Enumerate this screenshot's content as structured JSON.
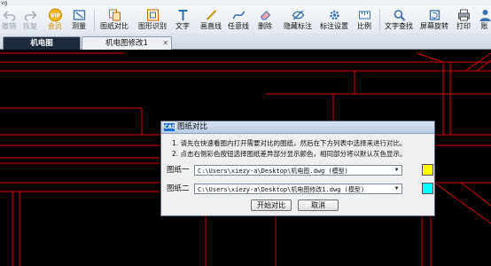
{
  "window": {
    "title": "vg"
  },
  "toolbar": {
    "items": [
      {
        "label": "撤销",
        "icon": "undo-icon",
        "enabled": false
      },
      {
        "label": "恢复",
        "icon": "redo-icon",
        "enabled": false
      },
      {
        "label": "会员",
        "icon": "vip-icon",
        "enabled": true
      },
      {
        "label": "测量",
        "icon": "measure-icon",
        "enabled": true
      },
      {
        "label": "图纸对比",
        "icon": "compare-icon",
        "enabled": true
      },
      {
        "label": "图形识别",
        "icon": "recognize-icon",
        "enabled": true
      },
      {
        "label": "文字",
        "icon": "text-icon",
        "enabled": true
      },
      {
        "label": "画直线",
        "icon": "line-icon",
        "enabled": true
      },
      {
        "label": "任意线",
        "icon": "freeline-icon",
        "enabled": true
      },
      {
        "label": "删除",
        "icon": "eraser-icon",
        "enabled": true
      },
      {
        "label": "隐藏标注",
        "icon": "hide-annotation-icon",
        "enabled": true
      },
      {
        "label": "标注设置",
        "icon": "annotation-settings-icon",
        "enabled": true
      },
      {
        "label": "比例",
        "icon": "scale-icon",
        "enabled": true
      },
      {
        "label": "文字查找",
        "icon": "text-search-icon",
        "enabled": true
      },
      {
        "label": "屏幕旋转",
        "icon": "rotate-icon",
        "enabled": true
      },
      {
        "label": "打印",
        "icon": "print-icon",
        "enabled": true
      },
      {
        "label": "账",
        "icon": "account-icon",
        "enabled": true
      }
    ]
  },
  "tabs": [
    {
      "label": "机电图",
      "active": true
    },
    {
      "label": "机电图修改1",
      "active": false
    }
  ],
  "dialog": {
    "title": "图纸对比",
    "icon_text": "CAD",
    "hint1": "1. 请先在快速看图内打开需要对比的图纸，然后在下方列表中选择来进行对比。",
    "hint2": "2. 点击右侧彩色按钮选择图纸差异部分显示颜色，相同部分将以默认灰色显示。",
    "drawing1": {
      "label": "图纸一",
      "value": "C:\\Users\\xiezy-a\\Desktop\\机电图.dwg (模型)",
      "color": "#ffff00"
    },
    "drawing2": {
      "label": "图纸二",
      "value": "C:\\Users\\xiezy-a\\Desktop\\机电图修改1.dwg (模型)",
      "color": "#00ffff"
    },
    "start_button": "开始对比",
    "cancel_button": "取消"
  },
  "colors": {
    "cad_red": "#d40000",
    "cad_background": "#000000",
    "active_tab": "#1d2b3d"
  }
}
